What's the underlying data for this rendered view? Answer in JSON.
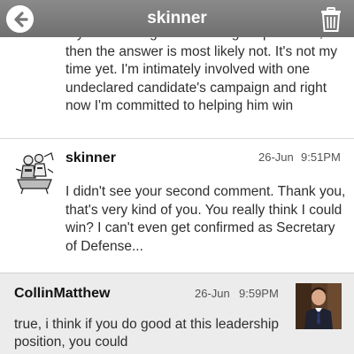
{
  "header": {
    "title": "skinner",
    "back_icon": "back-arrow-circle-icon",
    "trash_icon": "trash-icon"
  },
  "messages": [
    {
      "username": "",
      "date": "",
      "time": "",
      "text": "If you're asking if I'm running for president, then the answer is most likely not. It's not my time yet. I'm intimately involved with one undeclared candidate's campaign and right now I'm committed to helping him win"
    },
    {
      "username": "skinner",
      "date": "26-Jun",
      "time": "9:51PM",
      "avatar_icon": "cartoon-avatar-icon",
      "text": "I didn't see your second comment. Thank you, that's very kind of you. You really think I could win? I can't even get confirmed as Secretary of Defense..."
    },
    {
      "username": "CollinMatthew",
      "date": "26-Jun",
      "time": "9:59PM",
      "avatar_icon": "user-photo-icon",
      "text": "true, i think if you do good at this leadership position, you could"
    }
  ],
  "colors": {
    "header_bg": "#7d7d7d",
    "selected_row_bg": "#ececec",
    "text": "#2e2e2e"
  }
}
